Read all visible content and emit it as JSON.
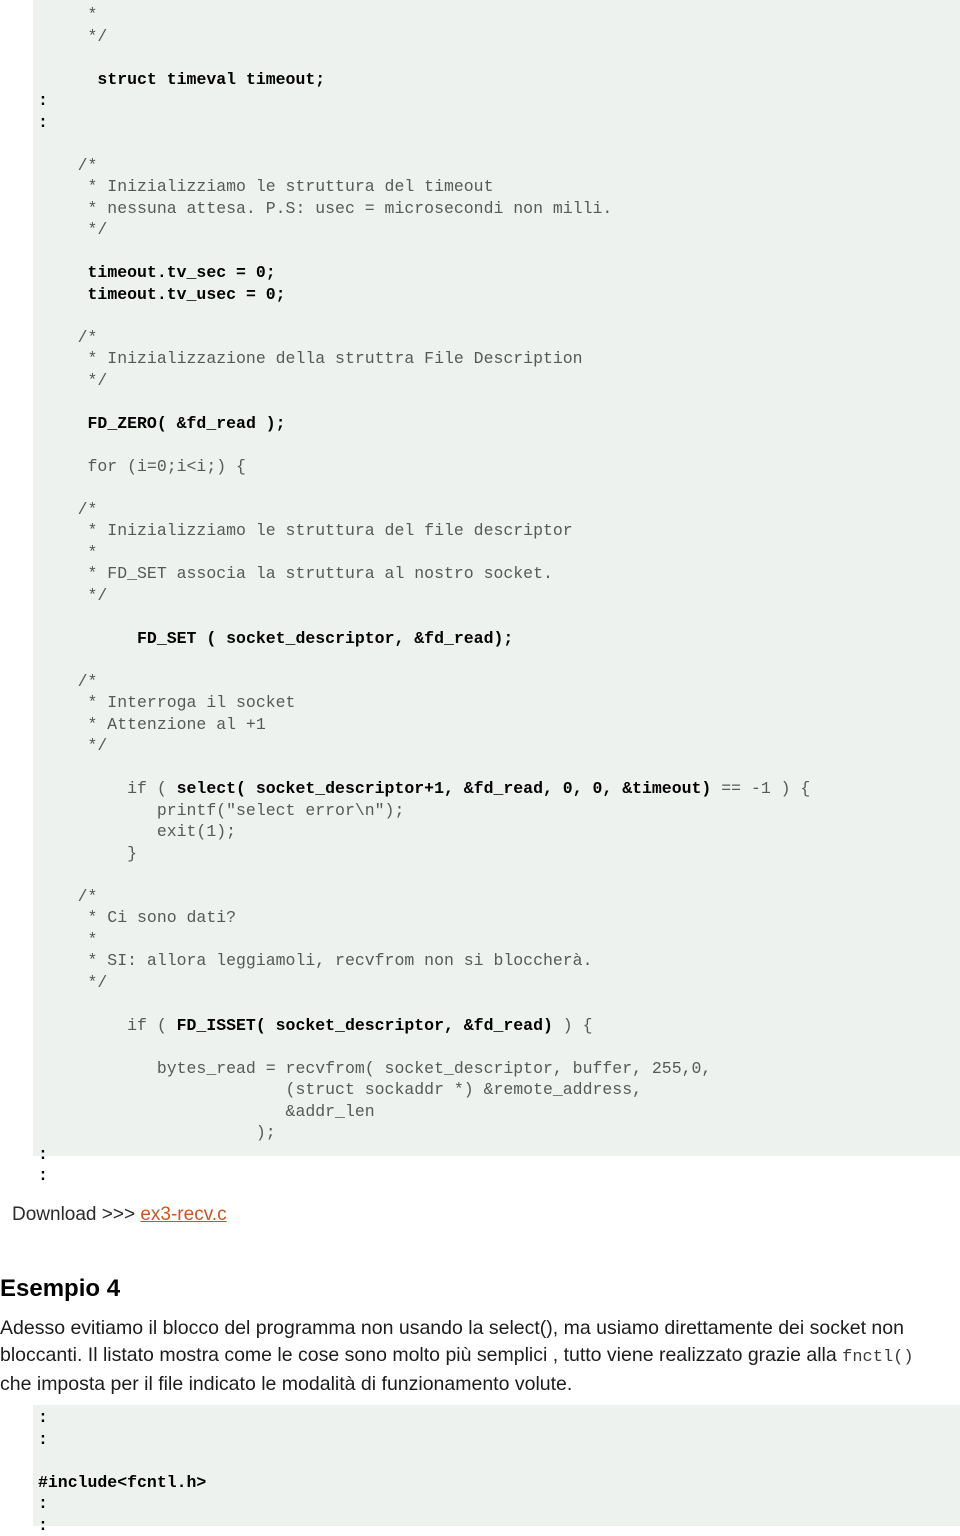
{
  "code_block_1": {
    "name": "select-example-code",
    "lines": [
      {
        "indent": 0,
        "segments": [
          {
            "t": "     *",
            "bold": false
          }
        ]
      },
      {
        "indent": 0,
        "segments": [
          {
            "t": "     */",
            "bold": false
          }
        ]
      },
      {
        "indent": 0,
        "segments": [
          {
            "t": "",
            "bold": false
          }
        ]
      },
      {
        "indent": 0,
        "segments": [
          {
            "t": "      ",
            "bold": false
          },
          {
            "t": "struct timeval timeout;",
            "bold": true
          }
        ]
      },
      {
        "indent": 0,
        "segments": [
          {
            "t": ":",
            "bold": true
          }
        ]
      },
      {
        "indent": 0,
        "segments": [
          {
            "t": ":",
            "bold": true
          }
        ]
      },
      {
        "indent": 0,
        "segments": [
          {
            "t": "",
            "bold": false
          }
        ]
      },
      {
        "indent": 0,
        "segments": [
          {
            "t": "    /*",
            "bold": false
          }
        ]
      },
      {
        "indent": 0,
        "segments": [
          {
            "t": "     * Inizializziamo le struttura del timeout",
            "bold": false
          }
        ]
      },
      {
        "indent": 0,
        "segments": [
          {
            "t": "     * nessuna attesa. P.S: usec = microsecondi non milli.",
            "bold": false
          }
        ]
      },
      {
        "indent": 0,
        "segments": [
          {
            "t": "     */",
            "bold": false
          }
        ]
      },
      {
        "indent": 0,
        "segments": [
          {
            "t": "",
            "bold": false
          }
        ]
      },
      {
        "indent": 0,
        "segments": [
          {
            "t": "     ",
            "bold": false
          },
          {
            "t": "timeout.tv_sec = 0;",
            "bold": true
          }
        ]
      },
      {
        "indent": 0,
        "segments": [
          {
            "t": "     ",
            "bold": false
          },
          {
            "t": "timeout.tv_usec = 0;",
            "bold": true
          }
        ]
      },
      {
        "indent": 0,
        "segments": [
          {
            "t": "",
            "bold": false
          }
        ]
      },
      {
        "indent": 0,
        "segments": [
          {
            "t": "    /*",
            "bold": false
          }
        ]
      },
      {
        "indent": 0,
        "segments": [
          {
            "t": "     * Inizializzazione della struttra File Description",
            "bold": false
          }
        ]
      },
      {
        "indent": 0,
        "segments": [
          {
            "t": "     */",
            "bold": false
          }
        ]
      },
      {
        "indent": 0,
        "segments": [
          {
            "t": "",
            "bold": false
          }
        ]
      },
      {
        "indent": 0,
        "segments": [
          {
            "t": "     ",
            "bold": false
          },
          {
            "t": "FD_ZERO( &fd_read );",
            "bold": true
          }
        ]
      },
      {
        "indent": 0,
        "segments": [
          {
            "t": "",
            "bold": false
          }
        ]
      },
      {
        "indent": 0,
        "segments": [
          {
            "t": "     for (i=0;i<i;) {",
            "bold": false
          }
        ]
      },
      {
        "indent": 0,
        "segments": [
          {
            "t": "",
            "bold": false
          }
        ]
      },
      {
        "indent": 0,
        "segments": [
          {
            "t": "    /*",
            "bold": false
          }
        ]
      },
      {
        "indent": 0,
        "segments": [
          {
            "t": "     * Inizializziamo le struttura del file descriptor",
            "bold": false
          }
        ]
      },
      {
        "indent": 0,
        "segments": [
          {
            "t": "     *",
            "bold": false
          }
        ]
      },
      {
        "indent": 0,
        "segments": [
          {
            "t": "     * FD_SET associa la struttura al nostro socket.",
            "bold": false
          }
        ]
      },
      {
        "indent": 0,
        "segments": [
          {
            "t": "     */",
            "bold": false
          }
        ]
      },
      {
        "indent": 0,
        "segments": [
          {
            "t": "",
            "bold": false
          }
        ]
      },
      {
        "indent": 0,
        "segments": [
          {
            "t": "          ",
            "bold": false
          },
          {
            "t": "FD_SET ( socket_descriptor, &fd_read);",
            "bold": true
          }
        ]
      },
      {
        "indent": 0,
        "segments": [
          {
            "t": "",
            "bold": false
          }
        ]
      },
      {
        "indent": 0,
        "segments": [
          {
            "t": "    /*",
            "bold": false
          }
        ]
      },
      {
        "indent": 0,
        "segments": [
          {
            "t": "     * Interroga il socket",
            "bold": false
          }
        ]
      },
      {
        "indent": 0,
        "segments": [
          {
            "t": "     * Attenzione al +1",
            "bold": false
          }
        ]
      },
      {
        "indent": 0,
        "segments": [
          {
            "t": "     */",
            "bold": false
          }
        ]
      },
      {
        "indent": 0,
        "segments": [
          {
            "t": "",
            "bold": false
          }
        ]
      },
      {
        "indent": 0,
        "segments": [
          {
            "t": "         if ( ",
            "bold": false
          },
          {
            "t": "select( socket_descriptor+1, &fd_read, 0, 0, &timeout)",
            "bold": true
          },
          {
            "t": " == -1 ) {",
            "bold": false
          }
        ]
      },
      {
        "indent": 0,
        "segments": [
          {
            "t": "            printf(\"select error\\n\");",
            "bold": false
          }
        ]
      },
      {
        "indent": 0,
        "segments": [
          {
            "t": "            exit(1);",
            "bold": false
          }
        ]
      },
      {
        "indent": 0,
        "segments": [
          {
            "t": "         }",
            "bold": false
          }
        ]
      },
      {
        "indent": 0,
        "segments": [
          {
            "t": "",
            "bold": false
          }
        ]
      },
      {
        "indent": 0,
        "segments": [
          {
            "t": "    /*",
            "bold": false
          }
        ]
      },
      {
        "indent": 0,
        "segments": [
          {
            "t": "     * Ci sono dati?",
            "bold": false
          }
        ]
      },
      {
        "indent": 0,
        "segments": [
          {
            "t": "     *",
            "bold": false
          }
        ]
      },
      {
        "indent": 0,
        "segments": [
          {
            "t": "     * SI: allora leggiamoli, recvfrom non si bloccherà.",
            "bold": false
          }
        ]
      },
      {
        "indent": 0,
        "segments": [
          {
            "t": "     */",
            "bold": false
          }
        ]
      },
      {
        "indent": 0,
        "segments": [
          {
            "t": "",
            "bold": false
          }
        ]
      },
      {
        "indent": 0,
        "segments": [
          {
            "t": "         if ( ",
            "bold": false
          },
          {
            "t": "FD_ISSET( socket_descriptor, &fd_read)",
            "bold": true
          },
          {
            "t": " ) {",
            "bold": false
          }
        ]
      },
      {
        "indent": 0,
        "segments": [
          {
            "t": "",
            "bold": false
          }
        ]
      },
      {
        "indent": 0,
        "segments": [
          {
            "t": "            bytes_read = recvfrom( socket_descriptor, buffer, 255,0,",
            "bold": false
          }
        ]
      },
      {
        "indent": 0,
        "segments": [
          {
            "t": "                         (struct sockaddr *) &remote_address,",
            "bold": false
          }
        ]
      },
      {
        "indent": 0,
        "segments": [
          {
            "t": "                         &addr_len",
            "bold": false
          }
        ]
      },
      {
        "indent": 0,
        "segments": [
          {
            "t": "                      );",
            "bold": false
          }
        ]
      },
      {
        "indent": 0,
        "segments": [
          {
            "t": ":",
            "bold": true
          }
        ]
      },
      {
        "indent": 0,
        "segments": [
          {
            "t": ":",
            "bold": true
          }
        ]
      }
    ]
  },
  "download": {
    "label": "Download >>> ",
    "link_text": "ex3-recv.c",
    "link_color": "#cc5522"
  },
  "heading": "Esempio 4",
  "paragraph": {
    "part1": "Adesso evitiamo il blocco del programma non usando la select(), ma usiamo direttamente dei socket non bloccanti. Il listato mostra come le cose sono molto più semplici , tutto viene realizzato grazie alla ",
    "mono": "fnctl()",
    "part2": " che imposta per il file indicato le modalità di funzionamento volute."
  },
  "code_block_2": {
    "name": "fcntl-include-code",
    "lines": [
      {
        "indent": 0,
        "segments": [
          {
            "t": ":",
            "bold": true
          }
        ]
      },
      {
        "indent": 0,
        "segments": [
          {
            "t": ":",
            "bold": true
          }
        ]
      },
      {
        "indent": 0,
        "segments": [
          {
            "t": "",
            "bold": false
          }
        ]
      },
      {
        "indent": 0,
        "segments": [
          {
            "t": "#include<fcntl.h>",
            "bold": true
          }
        ]
      },
      {
        "indent": 0,
        "segments": [
          {
            "t": ":",
            "bold": true
          }
        ]
      },
      {
        "indent": 0,
        "segments": [
          {
            "t": ":",
            "bold": true
          }
        ]
      }
    ]
  },
  "colors": {
    "code_background": "#eef2ef",
    "code_text": "#555a57",
    "code_bold_text": "#000000",
    "page_background": "#ffffff",
    "link": "#cc5522"
  }
}
